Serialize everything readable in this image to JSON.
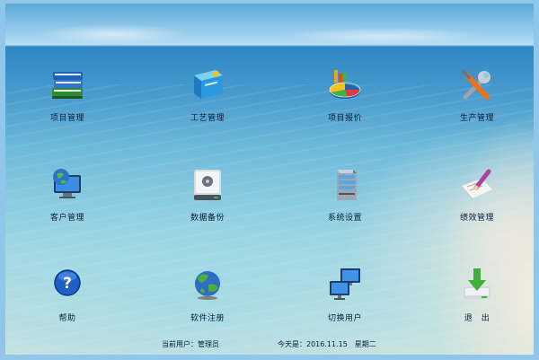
{
  "menu": {
    "project_mgmt": "项目管理",
    "process_mgmt": "工艺管理",
    "project_quote": "项目报价",
    "production_mgmt": "生产管理",
    "customer_mgmt": "客户管理",
    "data_backup": "数据备份",
    "system_settings": "系统设置",
    "performance_mgmt": "绩效管理",
    "help": "帮助",
    "software_register": "软件注册",
    "switch_user": "切换用户",
    "exit": "退　出"
  },
  "status": {
    "current_user": "当前用户：管理员",
    "today": "今天是：2016.11.15　星期二"
  },
  "icons": {
    "project_mgmt": "books-stack-icon",
    "process_mgmt": "book-blue-icon",
    "project_quote": "pie-chart-icon",
    "production_mgmt": "tools-icon",
    "customer_mgmt": "globe-monitor-icon",
    "data_backup": "hard-drive-icon",
    "system_settings": "server-icon",
    "performance_mgmt": "pencil-document-icon",
    "help": "help-icon",
    "software_register": "globe-icon",
    "switch_user": "network-monitors-icon",
    "exit": "download-arrow-icon"
  },
  "colors": {
    "frame": "#8fc6ea",
    "text": "#0a1e3a"
  }
}
